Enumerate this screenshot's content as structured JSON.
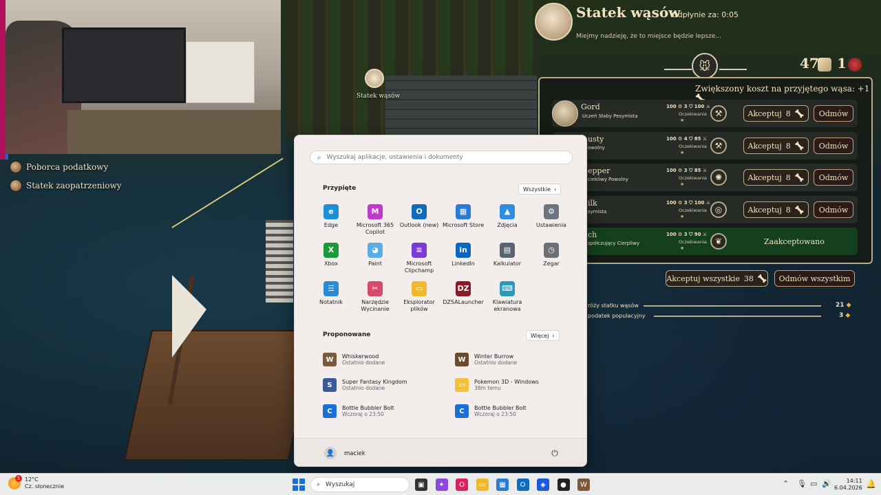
{
  "webcam": {},
  "game": {
    "ship_marker_label": "Statek wąsów",
    "side_items": [
      "Poborca podatkowy",
      "Statek zaopatrzeniowy"
    ],
    "panel": {
      "title": "Statek wąsów",
      "timer_label": "Odpłynie za:",
      "timer_value": "0:05",
      "subtitle": "Miejmy nadzieję, że to miejsce będzie lepsze...",
      "resource_count": "47",
      "token_count": "1",
      "cost_note": "Zwiększony koszt na przyjętego wąsa: +1",
      "rows": [
        {
          "name": "Gord",
          "traits": "Uczeń  Słaby  Pesymista",
          "stats": "100 ⚙ 3 ⛉ 100 ⚔",
          "status": "Oczekiwania",
          "stars": "★",
          "icon": "⚒",
          "accept": "Akceptuj",
          "cost": "8",
          "reject": "Odmów"
        },
        {
          "name": "usty",
          "traits": "owolny",
          "stats": "100 ⚙ 4 ⛉ 85 ⚔",
          "status": "Oczekiwania",
          "stars": "★",
          "icon": "⚒",
          "accept": "Akceptuj",
          "cost": "8",
          "reject": "Odmów"
        },
        {
          "name": "epper",
          "traits": "ciekliwy  Powolny",
          "stats": "100 ⚙ 3 ⛉ 85 ⚔",
          "status": "Oczekiwania",
          "stars": "★",
          "icon": "✺",
          "accept": "Akceptuj",
          "cost": "8",
          "reject": "Odmów"
        },
        {
          "name": "ilk",
          "traits": "symista",
          "stats": "100 ⚙ 3 ⛉ 100 ⚔",
          "status": "Oczekiwania",
          "stars": "★",
          "icon": "◎",
          "accept": "Akceptuj",
          "cost": "8",
          "reject": "Odmów"
        },
        {
          "name": "ch",
          "traits": "spółczujący  Cierpliwy",
          "stats": "100 ⚙ 3 ⛉ 90 ⚔",
          "status": "Oczekiwania",
          "stars": "★",
          "icon": "❦",
          "accepted_label": "Zaakceptowano"
        }
      ],
      "accept_all": "Akceptuj wszystkie",
      "accept_all_cost": "38",
      "reject_all": "Odmów wszystkim",
      "progress": [
        {
          "label": "róży statku wąsów",
          "value": "21"
        },
        {
          "label": "podatek populacyjny",
          "value": "3"
        }
      ]
    }
  },
  "start_menu": {
    "search_placeholder": "Wyszukaj aplikacje, ustawienia i dokumenty",
    "pinned_title": "Przypięte",
    "all_label": "Wszystkie",
    "pinned": [
      {
        "label": "Edge",
        "icon": "edge-icon",
        "color": "#1d8fd8",
        "glyph": "e"
      },
      {
        "label": "Microsoft 365 Copilot",
        "icon": "m365-copilot-icon",
        "color": "#c03ad0",
        "glyph": "M"
      },
      {
        "label": "Outlook (new)",
        "icon": "outlook-icon",
        "color": "#0f6cbd",
        "glyph": "O"
      },
      {
        "label": "Microsoft Store",
        "icon": "store-icon",
        "color": "#2a7ad8",
        "glyph": "▦"
      },
      {
        "label": "Zdjęcia",
        "icon": "photos-icon",
        "color": "#2e8fe0",
        "glyph": "▲"
      },
      {
        "label": "Ustawienia",
        "icon": "settings-icon",
        "color": "#6d7480",
        "glyph": "⚙"
      },
      {
        "label": "Xbox",
        "icon": "xbox-icon",
        "color": "#1a9a3a",
        "glyph": "X"
      },
      {
        "label": "Paint",
        "icon": "paint-icon",
        "color": "#5aaee8",
        "glyph": "◕"
      },
      {
        "label": "Microsoft Clipchamp",
        "icon": "clipchamp-icon",
        "color": "#7a3ad8",
        "glyph": "≡"
      },
      {
        "label": "LinkedIn",
        "icon": "linkedin-icon",
        "color": "#0a66c2",
        "glyph": "in"
      },
      {
        "label": "Kalkulator",
        "icon": "calculator-icon",
        "color": "#5a6470",
        "glyph": "▤"
      },
      {
        "label": "Zegar",
        "icon": "clock-icon",
        "color": "#6c6f74",
        "glyph": "◷"
      },
      {
        "label": "Notatnik",
        "icon": "notepad-icon",
        "color": "#2a8ad8",
        "glyph": "☰"
      },
      {
        "label": "Narzędzie Wycinanie",
        "icon": "snipping-tool-icon",
        "color": "#d84a6a",
        "glyph": "✂"
      },
      {
        "label": "Eksplorator plików",
        "icon": "file-explorer-icon",
        "color": "#f0b82a",
        "glyph": "▭"
      },
      {
        "label": "DZSALauncher",
        "icon": "dzsa-launcher-icon",
        "color": "#8a1a28",
        "glyph": "DZ"
      },
      {
        "label": "Klawiatura ekranowa",
        "icon": "keyboard-icon",
        "color": "#2a9ab8",
        "glyph": "⌨"
      }
    ],
    "recommended_title": "Proponowane",
    "more_label": "Więcej",
    "recommended": [
      {
        "title": "Whiskerwood",
        "subtitle": "Ostatnio dodane",
        "icon": "whiskerwood-icon",
        "color": "#7a5a3a",
        "glyph": "W"
      },
      {
        "title": "Winter Burrow",
        "subtitle": "Ostatnio dodane",
        "icon": "winter-burrow-icon",
        "color": "#6a4a2a",
        "glyph": "W"
      },
      {
        "title": "Super Fantasy Kingdom",
        "subtitle": "Ostatnio dodane",
        "icon": "super-fantasy-kingdom-icon",
        "color": "#3a5a9a",
        "glyph": "S"
      },
      {
        "title": "Pokemon 3D - Windows",
        "subtitle": "38m temu",
        "icon": "folder-icon",
        "color": "#f0c23a",
        "glyph": "▭"
      },
      {
        "title": "Bottle Bubbler Bolt",
        "subtitle": "Wczoraj o 23:50",
        "icon": "bottle-bubbler-icon",
        "color": "#1a6fd8",
        "glyph": "C"
      },
      {
        "title": "Bottle Bubbler Bolt",
        "subtitle": "Wczoraj o 23:50",
        "icon": "bottle-bubbler-icon",
        "color": "#1a6fd8",
        "glyph": "C"
      }
    ],
    "user_name": "maciek"
  },
  "taskbar": {
    "weather_temp": "12°C",
    "weather_desc": "Cz. słonecznie",
    "weather_badge": "1",
    "search_label": "Wyszukaj",
    "apps": [
      {
        "icon": "task-view-icon",
        "color": "#333",
        "glyph": "▣"
      },
      {
        "icon": "copilot-icon",
        "color": "#8a4ae0",
        "glyph": "✦"
      },
      {
        "icon": "opera-icon",
        "color": "#d8245a",
        "glyph": "O"
      },
      {
        "icon": "file-explorer-icon",
        "color": "#f0b82a",
        "glyph": "▭"
      },
      {
        "icon": "store-icon",
        "color": "#2a7ad8",
        "glyph": "▦"
      },
      {
        "icon": "outlook-icon",
        "color": "#0f6cbd",
        "glyph": "O"
      },
      {
        "icon": "cube-app-icon",
        "color": "#1a5ad8",
        "glyph": "◈"
      },
      {
        "icon": "obs-icon",
        "color": "#222",
        "glyph": "●"
      },
      {
        "icon": "game-icon",
        "color": "#7a5a3a",
        "glyph": "W"
      }
    ],
    "time": "14:11",
    "date": "6.04.2026"
  }
}
